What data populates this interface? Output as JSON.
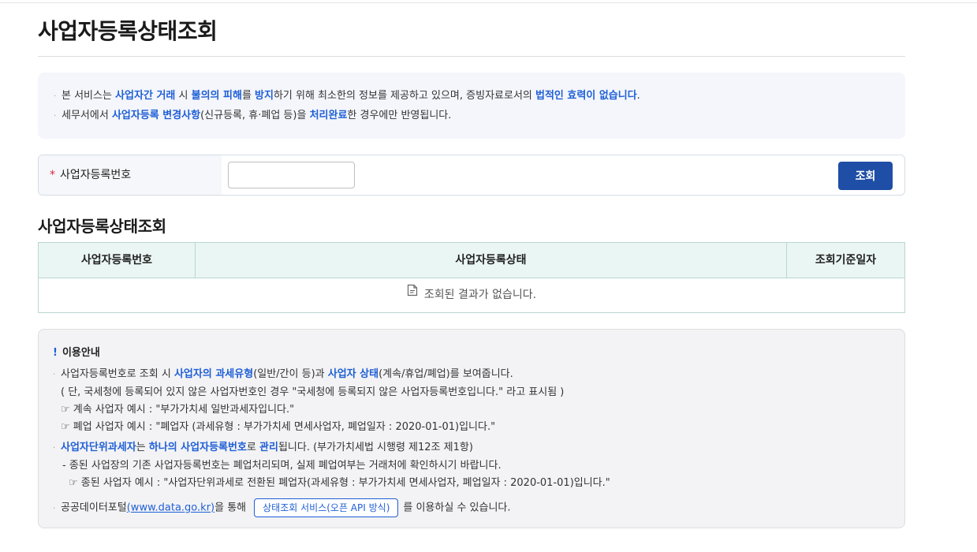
{
  "page": {
    "title": "사업자등록상태조회"
  },
  "notice": {
    "line1": {
      "bullet": "·",
      "t1": "본 서비스는 ",
      "h1": "사업자간 거래",
      "t2": " 시 ",
      "h2": "불의의 피해",
      "t3": "를 ",
      "h3": "방지",
      "t4": "하기 위해 최소한의 정보를 제공하고 있으며, 증빙자료로서의 ",
      "h4": "법적인 효력이 없습니다",
      "t5": "."
    },
    "line2": {
      "bullet": "·",
      "t1": "세무서에서 ",
      "h1": "사업자등록 변경사항",
      "t2": "(신규등록, 휴·폐업 등)을 ",
      "h2": "처리완료",
      "t3": "한 경우에만 반영됩니다."
    }
  },
  "search": {
    "required_mark": "*",
    "label": "사업자등록번호",
    "input_value": "",
    "button_label": "조회"
  },
  "results": {
    "section_title": "사업자등록상태조회",
    "columns": [
      "사업자등록번호",
      "사업자등록상태",
      "조회기준일자"
    ],
    "empty_message": "조회된 결과가 없습니다."
  },
  "guide": {
    "mark": "!",
    "title": "이용안내",
    "item1": {
      "bullet": "·",
      "t1": "사업자등록번호로 조회 시 ",
      "h1": "사업자의 과세유형",
      "t2": "(일반/간이 등)과 ",
      "h2": "사업자 상태",
      "t3": "(계속/휴업/폐업)를 보여줍니다."
    },
    "item1_note": "( 단, 국세청에 등록되어 있지 않은 사업자번호인 경우 \"국세청에 등록되지 않은 사업자등록번호입니다.\" 라고 표시됨 )",
    "item1_ex1": "☞ 계속 사업자 예시 : \"부가가치세 일반과세자입니다.\"",
    "item1_ex2": "☞ 폐업 사업자 예시 : \"폐업자 (과세유형 : 부가가치세 면세사업자, 폐업일자 : 2020-01-01)입니다.\"",
    "item2": {
      "bullet": "·",
      "h1": "사업자단위과세자",
      "t1": "는 ",
      "h2": "하나의 사업자등록번호",
      "t2": "로 ",
      "h3": "관리",
      "t3": "됩니다. (부가가치세법 시행령 제12조 제1항)"
    },
    "item2_sub": "- 종된 사업장의 기존 사업자등록번호는 폐업처리되며, 실제 폐업여부는 거래처에 확인하시기 바랍니다.",
    "item2_ex": "☞ 종된 사업자 예시 : \"사업자단위과세로 전환된 폐업자(과세유형 : 부가가치세 면세사업자, 폐업일자 : 2020-01-01)입니다.\"",
    "item3": {
      "bullet": "·",
      "t1": "공공데이터포털",
      "link": "(www.data.go.kr)",
      "t2": "을 통해",
      "button": "상태조회 서비스(오픈 API 방식)",
      "t3": "를 이용하실 수 있습니다."
    }
  },
  "colors": {
    "accent_blue": "#1f5fd6",
    "button_navy": "#1f4ea6",
    "required_red": "#e0243b",
    "table_header_bg": "#eaf6f3"
  }
}
